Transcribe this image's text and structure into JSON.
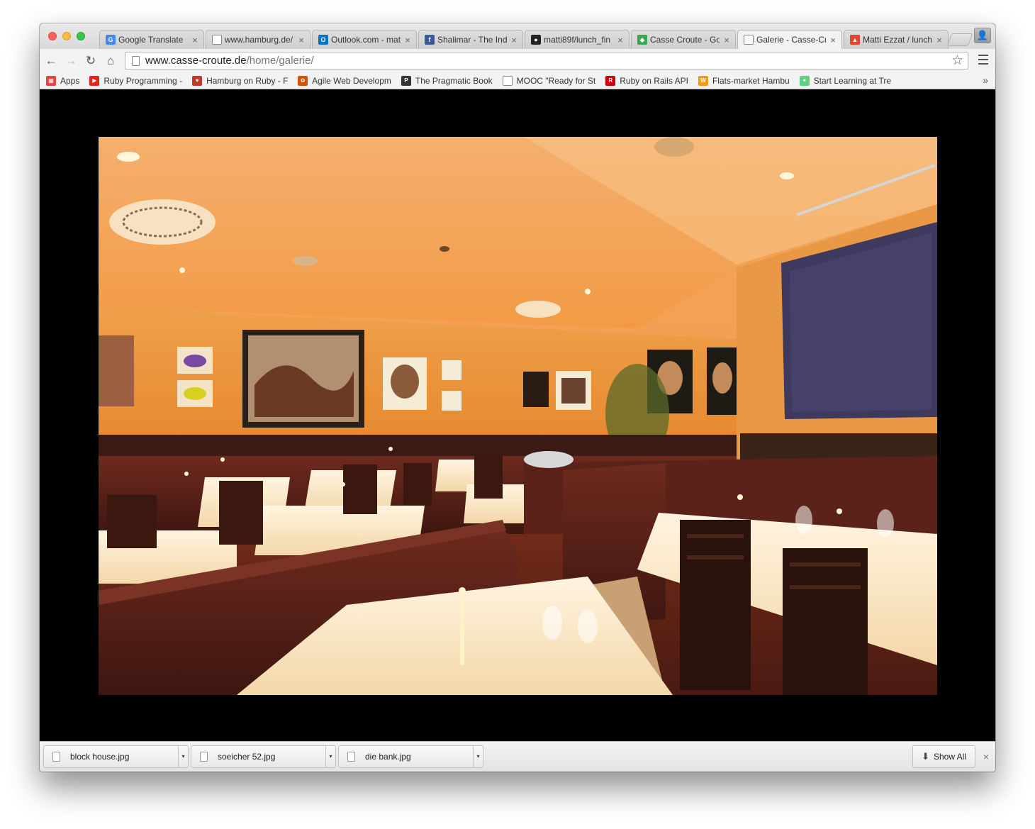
{
  "browser": {
    "tabs": [
      {
        "title": "Google Translate",
        "icon": "google-translate-icon",
        "color": "#4285f4",
        "glyph": "G"
      },
      {
        "title": "www.hamburg.de/",
        "icon": "page-icon",
        "color": "#ffffff",
        "glyph": ""
      },
      {
        "title": "Outlook.com - mat",
        "icon": "outlook-icon",
        "color": "#0072c6",
        "glyph": "O"
      },
      {
        "title": "Shalimar - The Indi",
        "icon": "facebook-icon",
        "color": "#3b5998",
        "glyph": "f"
      },
      {
        "title": "matti89f/lunch_fin",
        "icon": "github-icon",
        "color": "#222222",
        "glyph": "●"
      },
      {
        "title": "Casse Croute - Go",
        "icon": "google-maps-icon",
        "color": "#34a853",
        "glyph": "◆"
      },
      {
        "title": "Galerie - Casse-Cr",
        "icon": "page-icon",
        "color": "#ffffff",
        "glyph": ""
      },
      {
        "title": "Matti Ezzat / lunch",
        "icon": "gitlab-icon",
        "color": "#e24329",
        "glyph": "▲"
      }
    ],
    "nav": {
      "back": "←",
      "forward": "→",
      "reload": "↻",
      "home": "⌂"
    },
    "url": {
      "domain": "www.casse-croute.de",
      "path": "/home/galerie/"
    },
    "star": "☆",
    "profile": "👤",
    "bookmarks": [
      {
        "label": "Apps",
        "icon": "apps-icon",
        "color": "#e8453c",
        "glyph": "▦"
      },
      {
        "label": "Ruby Programming -",
        "icon": "youtube-icon",
        "color": "#e62117",
        "glyph": "▶"
      },
      {
        "label": "Hamburg on Ruby - F",
        "icon": "hamburg-icon",
        "color": "#c0392b",
        "glyph": "♥"
      },
      {
        "label": "Agile Web Developm",
        "icon": "agile-icon",
        "color": "#d35400",
        "glyph": "✿"
      },
      {
        "label": "The Pragmatic Book",
        "icon": "pragmatic-icon",
        "color": "#333333",
        "glyph": "P"
      },
      {
        "label": "MOOC \"Ready for St",
        "icon": "page-icon",
        "color": "#ffffff",
        "glyph": ""
      },
      {
        "label": "Ruby on Rails API",
        "icon": "rails-icon",
        "color": "#cc0000",
        "glyph": "R"
      },
      {
        "label": "Flats-market Hambu",
        "icon": "wg-icon",
        "color": "#f39c12",
        "glyph": "W"
      },
      {
        "label": "Start Learning at Tre",
        "icon": "treehouse-icon",
        "color": "#5fcf80",
        "glyph": "✦"
      }
    ],
    "bookmarks_overflow": "»"
  },
  "page": {
    "image_alt": "Restaurant interior"
  },
  "downloads": {
    "items": [
      {
        "name": "block house.jpg"
      },
      {
        "name": "soeicher 52.jpg"
      },
      {
        "name": "die bank.jpg"
      }
    ],
    "dropdown_glyph": "▾",
    "show_all_label": "Show All",
    "show_all_icon": "⬇",
    "close": "×"
  }
}
